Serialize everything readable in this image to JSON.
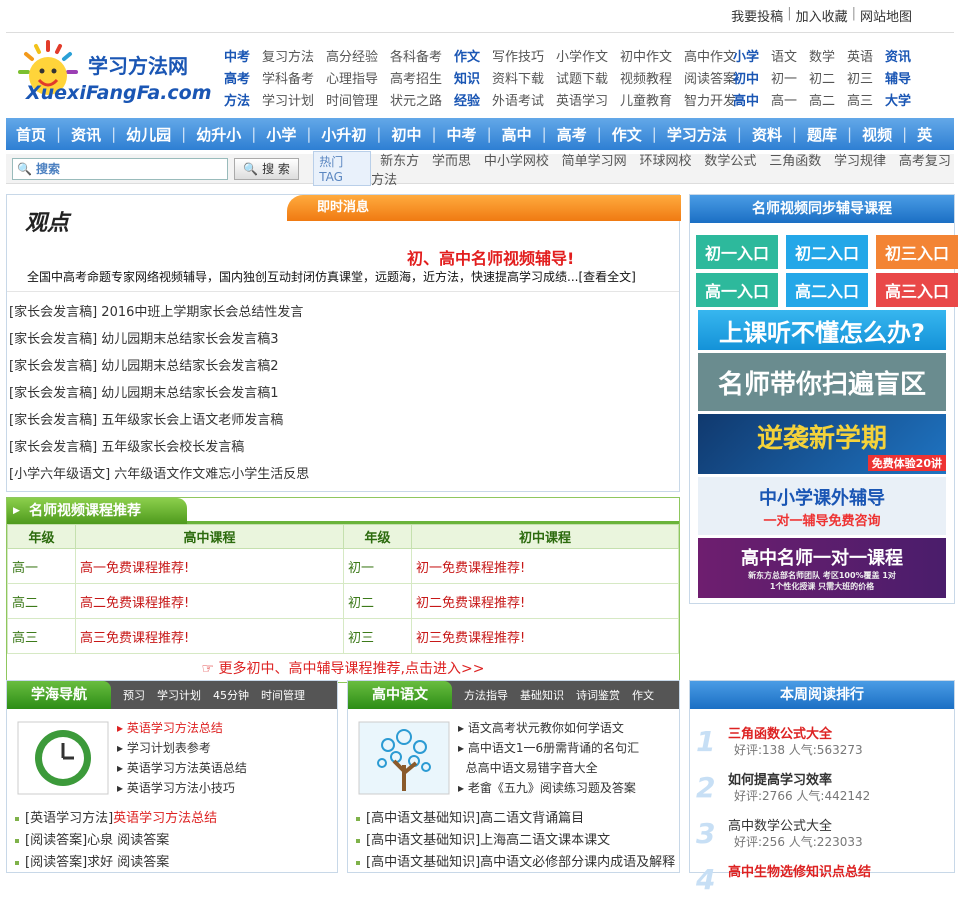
{
  "topbar": {
    "links": [
      "我要投稿",
      "加入收藏",
      "网站地图"
    ]
  },
  "logo": {
    "cn": "学习方法网",
    "en": "XuexiFangFa.com"
  },
  "navgrid": {
    "g1": [
      {
        "k": "中考",
        "i": [
          "复习方法",
          "高分经验",
          "各科备考"
        ]
      },
      {
        "k": "高考",
        "i": [
          "学科备考",
          "心理指导",
          "高考招生"
        ]
      },
      {
        "k": "方法",
        "i": [
          "学习计划",
          "时间管理",
          "状元之路"
        ]
      }
    ],
    "g2": [
      {
        "k": "作文",
        "i": [
          "写作技巧",
          "小学作文",
          "初中作文",
          "高中作文"
        ]
      },
      {
        "k": "知识",
        "i": [
          "资料下载",
          "试题下载",
          "视频教程",
          "阅读答案"
        ]
      },
      {
        "k": "经验",
        "i": [
          "外语考试",
          "英语学习",
          "儿童教育",
          "智力开发"
        ]
      }
    ],
    "g3": [
      {
        "k": "小学",
        "i": [
          "语文",
          "数学",
          "英语"
        ],
        "e": "资讯"
      },
      {
        "k": "初中",
        "i": [
          "初一",
          "初二",
          "初三"
        ],
        "e": "辅导"
      },
      {
        "k": "高中",
        "i": [
          "高一",
          "高二",
          "高三"
        ],
        "e": "大学"
      }
    ]
  },
  "mainnav": [
    "首页",
    "资讯",
    "幼儿园",
    "幼升小",
    "小学",
    "小升初",
    "初中",
    "中考",
    "高中",
    "高考",
    "作文",
    "学习方法",
    "资料",
    "题库",
    "视频",
    "英"
  ],
  "search": {
    "placeholder": "搜索",
    "button": "搜 索",
    "hot": "热门TAG",
    "tags": [
      "新东方",
      "学而思",
      "中小学网校",
      "简单学习网",
      "环球网校",
      "数学公式",
      "三角函数",
      "学习规律",
      "高考复习方法"
    ]
  },
  "guandian": {
    "title": "观点",
    "tab": "即时消息",
    "headline": "初、高中名师视频辅导!",
    "desc": "全国中高考命题专家网络视频辅导，国内独创互动封闭仿真课堂，远题海，近方法，快速提高学习成绩...",
    "more": "[查看全文]",
    "items": [
      {
        "cat": "[家长会发言稿]",
        "t": "2016中班上学期家长会总结性发言"
      },
      {
        "cat": "[家长会发言稿]",
        "t": "幼儿园期末总结家长会发言稿3"
      },
      {
        "cat": "[家长会发言稿]",
        "t": "幼儿园期末总结家长会发言稿2"
      },
      {
        "cat": "[家长会发言稿]",
        "t": "幼儿园期末总结家长会发言稿1"
      },
      {
        "cat": "[家长会发言稿]",
        "t": "五年级家长会上语文老师发言稿"
      },
      {
        "cat": "[家长会发言稿]",
        "t": "五年级家长会校长发言稿"
      },
      {
        "cat": "[小学六年级语文]",
        "t": "六年级语文作文难忘小学生活反思"
      }
    ]
  },
  "rec": {
    "tab": "名师视频课程推荐",
    "headers": [
      "年级",
      "高中课程",
      "年级",
      "初中课程"
    ],
    "rows": [
      [
        "高一",
        "高一免费课程推荐!",
        "初一",
        "初一免费课程推荐!"
      ],
      [
        "高二",
        "高二免费课程推荐!",
        "初二",
        "初二免费课程推荐!"
      ],
      [
        "高三",
        "高三免费课程推荐!",
        "初三",
        "初三免费课程推荐!"
      ]
    ],
    "more": "☞ 更多初中、高中辅导课程推荐,点击进入>>"
  },
  "right": {
    "title": "名师视频同步辅导课程",
    "entries": [
      "初一入口",
      "初二入口",
      "初三入口",
      "高一入口",
      "高二入口",
      "高三入口"
    ],
    "banners": [
      "上课听不懂怎么办?",
      "名师带你扫遍盲区",
      "逆袭新学期",
      "中小学课外辅导",
      "高中名师一对一课程"
    ],
    "banner_subs": [
      "免费体验20讲",
      "一对一辅导免费咨询",
      "新东方总部名师团队  考区100%覆盖  1对1个性化授课  只需大班的价格"
    ]
  },
  "xuehai": {
    "tab": "学海导航",
    "subs": [
      "预习",
      "学习计划",
      "45分钟",
      "时间管理"
    ],
    "feat": [
      "英语学习方法总结",
      "学习计划表参考",
      "英语学习方法英语总结",
      "英语学习方法小技巧"
    ],
    "list": [
      {
        "c": "[英语学习方法]",
        "t": "英语学习方法总结"
      },
      {
        "c": "[阅读答案]",
        "t": "心泉  阅读答案"
      },
      {
        "c": "[阅读答案]",
        "t": "求好  阅读答案"
      }
    ]
  },
  "yuwen": {
    "tab": "高中语文",
    "subs": [
      "方法指导",
      "基础知识",
      "诗词鉴赏",
      "作文"
    ],
    "feat": [
      "语文高考状元教你如何学语文",
      "高中语文1一6册需背诵的名句汇",
      "总高中语文易错字音大全",
      "老畲《五九》阅读练习题及答案"
    ],
    "list": [
      {
        "c": "[高中语文基础知识]",
        "t": "高二语文背诵篇目"
      },
      {
        "c": "[高中语文基础知识]",
        "t": "上海高二语文课本课文"
      },
      {
        "c": "[高中语文基础知识]",
        "t": "高中语文必修部分课内成语及解释"
      }
    ]
  },
  "rank": {
    "title": "本周阅读排行",
    "items": [
      {
        "n": "1",
        "t": "三角函数公式大全",
        "s": "好评:138  人气:563273",
        "red": true
      },
      {
        "n": "2",
        "t": "如何提高学习效率",
        "s": "好评:2766  人气:442142",
        "red": false
      },
      {
        "n": "3",
        "t": "高中数学公式大全",
        "s": "好评:256  人气:223033",
        "red": false
      },
      {
        "n": "4",
        "t": "高中生物选修知识点总结",
        "s": "",
        "red": true
      }
    ]
  }
}
